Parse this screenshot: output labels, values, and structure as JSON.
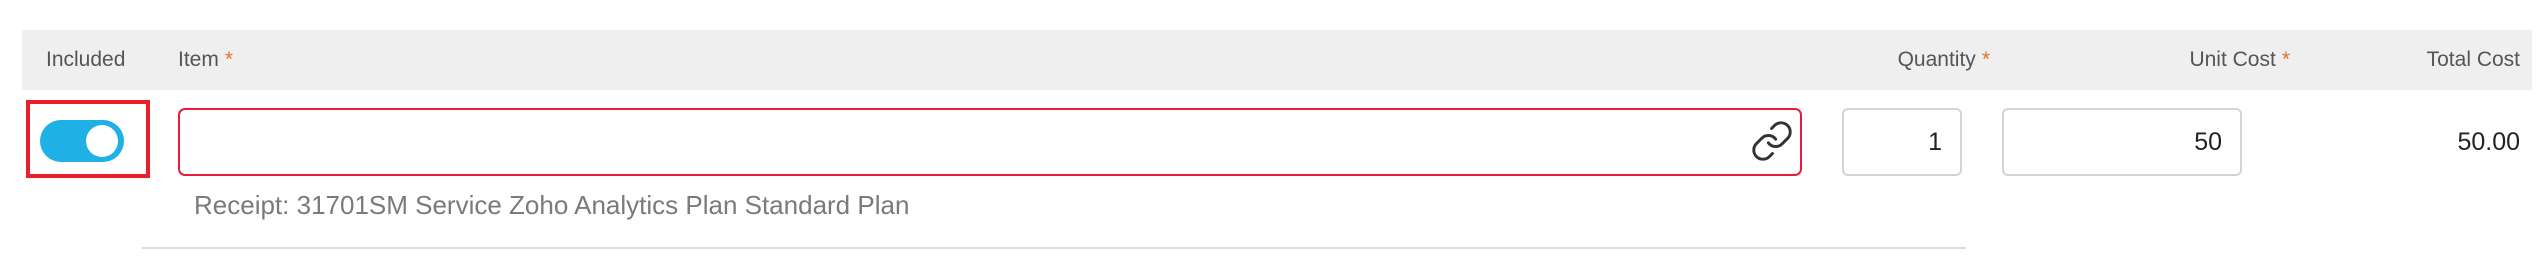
{
  "table": {
    "headers": {
      "included": "Included",
      "item": "Item",
      "quantity": "Quantity",
      "unit_cost": "Unit Cost",
      "total_cost": "Total Cost",
      "required_marker": "*"
    },
    "row": {
      "included_on": true,
      "item_value": "",
      "item_icon": "link-icon",
      "quantity": "1",
      "unit_cost": "50",
      "total_cost": "50.00",
      "receipt_note": "Receipt: 31701SM Service Zoho Analytics Plan Standard Plan"
    }
  },
  "colors": {
    "required_asterisk": "#e8702a",
    "toggle_on": "#1fb0e5",
    "error_border": "#e81c38",
    "highlight_box": "#e8202a",
    "header_bg": "#efefef"
  }
}
